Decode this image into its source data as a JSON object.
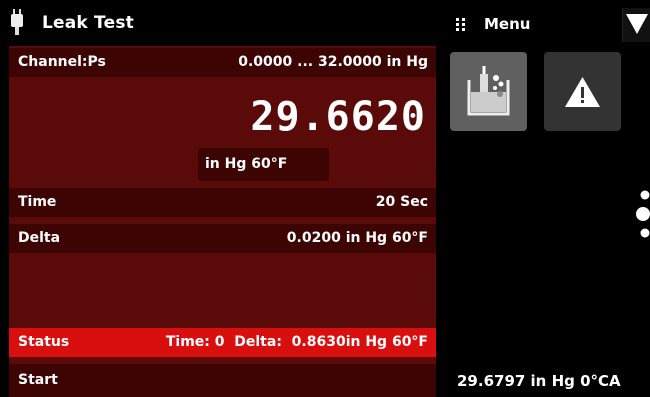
{
  "header": {
    "title": "Leak Test",
    "menu_label": "Menu"
  },
  "channel": {
    "label": "Channel:Ps",
    "range": "0.0000 ... 32.0000 in Hg"
  },
  "reading": {
    "value": "29.6620",
    "unit": "in Hg 60°F"
  },
  "time": {
    "label": "Time",
    "value": "20 Sec"
  },
  "delta": {
    "label": "Delta",
    "value": "0.0200 in Hg 60°F"
  },
  "status": {
    "label": "Status",
    "value": "Time: 0  Delta:  0.8630in Hg 60°F"
  },
  "start": {
    "label": "Start"
  },
  "side": {
    "tiles": [
      {
        "icon": "leak-test-icon"
      },
      {
        "icon": "warning-icon"
      }
    ],
    "bottom_reading": "29.6797 in Hg 0°CA"
  },
  "colors": {
    "panel": "#5b0a0a",
    "row": "#3d0404",
    "status_bar": "#d90f0f",
    "tile_active": "#606060",
    "tile_inactive": "#333333"
  }
}
